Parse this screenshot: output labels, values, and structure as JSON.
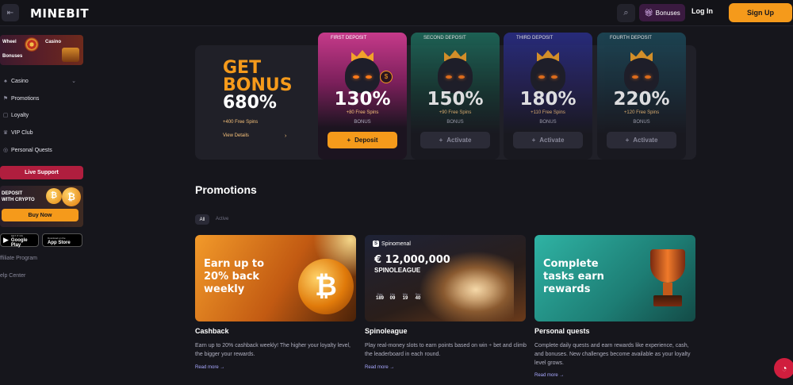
{
  "header": {
    "logo": "MINEBIT",
    "bonuses_label": "Bonuses",
    "login_label": "Log In",
    "signup_label": "Sign Up"
  },
  "sidebar": {
    "banner": {
      "wheel": "Wheel",
      "casino": "Casino",
      "bonuses": "Bonuses"
    },
    "items": [
      {
        "label": "Casino",
        "icon": "casino-icon"
      },
      {
        "label": "Promotions",
        "icon": "flag-icon"
      },
      {
        "label": "Loyalty",
        "icon": "chat-icon"
      },
      {
        "label": "VIP Club",
        "icon": "crown-icon"
      },
      {
        "label": "Personal Quests",
        "icon": "target-icon"
      }
    ],
    "live_support": "Live Support",
    "crypto": {
      "line1": "DEPOSIT",
      "line2": "WITH CRYPTO",
      "buy_label": "Buy Now"
    },
    "google_play": {
      "small": "GET IT ON",
      "big": "Google Play"
    },
    "app_store": {
      "small": "Download on the",
      "big": "App Store"
    },
    "affiliate": "ffiliate Program",
    "help": "elp Center"
  },
  "bonus": {
    "title_line1": "GET",
    "title_line2": "BONUS",
    "title_line3": "680%",
    "spins": "+400 Free Spins",
    "details_label": "View Details",
    "details_arrow": "›",
    "cards": [
      {
        "label": "FIRST DEPOSIT",
        "percent": "130%",
        "spins": "+80 Free Spins",
        "sub": "BONUS",
        "button": "Deposit",
        "btn_icon": "+"
      },
      {
        "label": "SECOND DEPOSIT",
        "percent": "150%",
        "spins": "+90 Free Spins",
        "sub": "BONUS",
        "button": "Activate",
        "btn_icon": "+"
      },
      {
        "label": "THIRD DEPOSIT",
        "percent": "180%",
        "spins": "+110 Free Spins",
        "sub": "BONUS",
        "button": "Activate",
        "btn_icon": "+"
      },
      {
        "label": "FOURTH DEPOSIT",
        "percent": "220%",
        "spins": "+120 Free Spins",
        "sub": "BONUS",
        "button": "Activate",
        "btn_icon": "+"
      }
    ]
  },
  "promotions": {
    "title": "Promotions",
    "filters": [
      "All",
      "Active"
    ],
    "cards": [
      {
        "image_text": [
          "Earn up to",
          "20% back",
          "weekly"
        ],
        "name": "Cashback",
        "desc": "Earn up to 20% cashback weekly! The higher your loyalty level, the bigger your rewards.",
        "more": "Read more →"
      },
      {
        "brand": "Spinomenal",
        "amount": "€ 12,000,000",
        "league": "SPINOLEAGUE",
        "timer": [
          {
            "label": "Day",
            "value": "189"
          },
          {
            "label": "Hrs",
            "value": "09"
          },
          {
            "label": "Min",
            "value": "19"
          },
          {
            "label": "Sec",
            "value": "40"
          }
        ],
        "name": "Spinoleague",
        "desc": "Play real-money slots to earn points based on win ÷ bet and climb the leaderboard in each round.",
        "more": "Read more →"
      },
      {
        "image_text": [
          "Complete",
          "tasks earn",
          "rewards"
        ],
        "name": "Personal quests",
        "desc": "Complete daily quests and earn rewards like experience, cash, and bonuses. New challenges become available as your loyalty level grows.",
        "more": "Read more →"
      }
    ]
  },
  "colors": {
    "accent": "#f59a1b",
    "support": "#b01e3e",
    "bg": "#16161c"
  }
}
